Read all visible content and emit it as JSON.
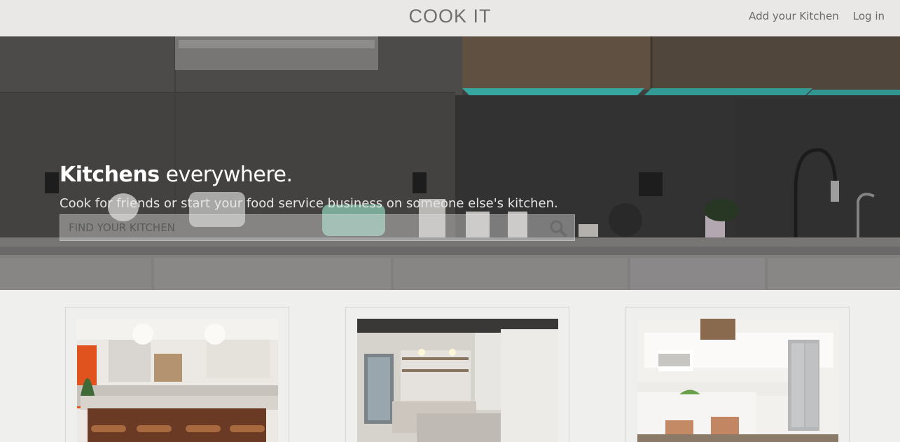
{
  "header": {
    "brand": "COOK IT",
    "nav": [
      {
        "label": "Add your Kitchen"
      },
      {
        "label": "Log in"
      }
    ]
  },
  "hero": {
    "title_bold": "Kitchens",
    "title_rest": " everywhere.",
    "subtitle": "Cook for friends or start your food service business on someone else's kitchen.",
    "search_placeholder": "FIND YOUR KITCHEN",
    "search_icon": "magnifier-icon"
  },
  "listings": [
    {
      "image": "kitchen-photo-white-island-pendants"
    },
    {
      "image": "kitchen-photo-cafe-counter"
    },
    {
      "image": "kitchen-photo-white-cabinets-stools"
    }
  ],
  "colors": {
    "header_bg": "#e9e8e6",
    "page_bg": "#efefee",
    "accent_led": "#3ec8c0"
  }
}
